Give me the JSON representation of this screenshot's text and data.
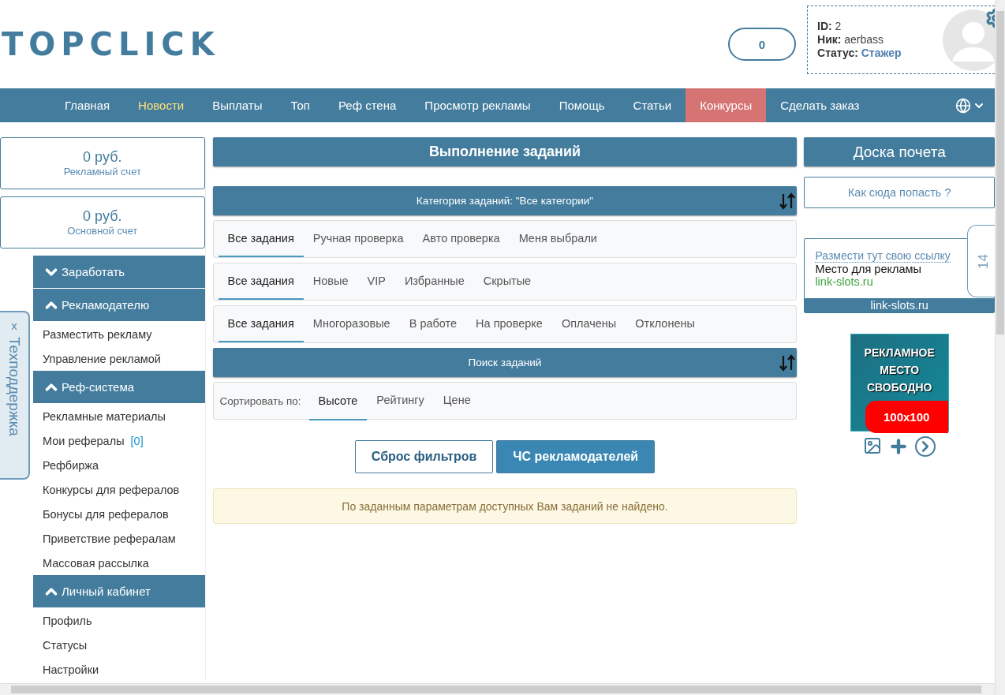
{
  "header": {
    "logo": "TOPCLICK",
    "counter": "0",
    "profile": [
      {
        "label": "ID:",
        "value": "2",
        "kind": "plain"
      },
      {
        "label": "Ник:",
        "value": "aerbass",
        "kind": "plain"
      },
      {
        "label": "Статус:",
        "value": "Стажер",
        "kind": "link"
      }
    ]
  },
  "nav": [
    {
      "label": "Главная",
      "selected": false,
      "kind": "plain"
    },
    {
      "label": "Новости",
      "selected": false,
      "kind": "news"
    },
    {
      "label": "Выплаты",
      "selected": false,
      "kind": "plain"
    },
    {
      "label": "Топ",
      "selected": false,
      "kind": "plain"
    },
    {
      "label": "Реф стена",
      "selected": false,
      "kind": "plain"
    },
    {
      "label": "Просмотр рекламы",
      "selected": false,
      "kind": "plain"
    },
    {
      "label": "Помощь",
      "selected": false,
      "kind": "plain"
    },
    {
      "label": "Статьи",
      "selected": false,
      "kind": "plain"
    },
    {
      "label": "Конкурсы",
      "selected": true,
      "kind": "plain"
    },
    {
      "label": "Сделать заказ",
      "selected": false,
      "kind": "plain"
    }
  ],
  "balances": [
    {
      "amount": "0 руб.",
      "label": "Рекламный счет"
    },
    {
      "amount": "0 руб.",
      "label": "Основной счет"
    }
  ],
  "sidebar": [
    {
      "label": "Заработать",
      "expanded": false
    },
    {
      "label": "Рекламодателю",
      "expanded": true,
      "children": [
        {
          "label": "Разместить рекламу"
        },
        {
          "label": "Управление рекламой"
        }
      ]
    },
    {
      "label": "Реф-система",
      "expanded": true,
      "children": [
        {
          "label": "Рекламные материалы"
        },
        {
          "label": "Мои рефералы",
          "count": "[0]"
        },
        {
          "label": "Рефбиржа"
        },
        {
          "label": "Конкурсы для рефералов"
        },
        {
          "label": "Бонусы для рефералов"
        },
        {
          "label": "Приветствие рефералам"
        },
        {
          "label": "Массовая рассылка"
        }
      ]
    },
    {
      "label": "Личный кабинет",
      "expanded": true,
      "children": [
        {
          "label": "Профиль"
        },
        {
          "label": "Статусы"
        },
        {
          "label": "Настройки"
        }
      ]
    }
  ],
  "support_tab": {
    "close": "x",
    "label": "Техподдержка"
  },
  "main": {
    "title": "Выполнение заданий",
    "category_bar": "Категория заданий: \"Все категории\"",
    "tab_rows": [
      [
        {
          "label": "Все задания",
          "selected": true
        },
        {
          "label": "Ручная проверка",
          "selected": false
        },
        {
          "label": "Авто проверка",
          "selected": false
        },
        {
          "label": "Меня выбрали",
          "selected": false
        }
      ],
      [
        {
          "label": "Все задания",
          "selected": true
        },
        {
          "label": "Новые",
          "selected": false
        },
        {
          "label": "VIP",
          "selected": false
        },
        {
          "label": "Избранные",
          "selected": false
        },
        {
          "label": "Скрытые",
          "selected": false
        }
      ],
      [
        {
          "label": "Все задания",
          "selected": true
        },
        {
          "label": "Многоразовые",
          "selected": false
        },
        {
          "label": "В работе",
          "selected": false
        },
        {
          "label": "На проверке",
          "selected": false
        },
        {
          "label": "Оплачены",
          "selected": false
        },
        {
          "label": "Отклонены",
          "selected": false
        }
      ]
    ],
    "search_bar": "Поиск заданий",
    "sort_label": "Сортировать по:",
    "sort_tabs": [
      {
        "label": "Высоте",
        "selected": true
      },
      {
        "label": "Рейтингу",
        "selected": false
      },
      {
        "label": "Цене",
        "selected": false
      }
    ],
    "buttons": [
      {
        "label": "Сброс фильтров",
        "kind": "outline"
      },
      {
        "label": "ЧС рекламодателей",
        "kind": "primary"
      }
    ],
    "notice": "По заданным параметрам доступных Вам заданий не найдено."
  },
  "right": {
    "title": "Доска почета",
    "how_link": "Как сюда попасть ?",
    "ad": {
      "link": "Размести тут свою ссылку",
      "text": "Место для рекламы",
      "url": "link-slots.ru",
      "footer": "link-slots.ru"
    },
    "side_tab": "14",
    "banner": {
      "lines": [
        "РЕКЛАМНОЕ",
        "МЕСТО",
        "СВОБОДНО"
      ],
      "size": "100x100"
    }
  }
}
